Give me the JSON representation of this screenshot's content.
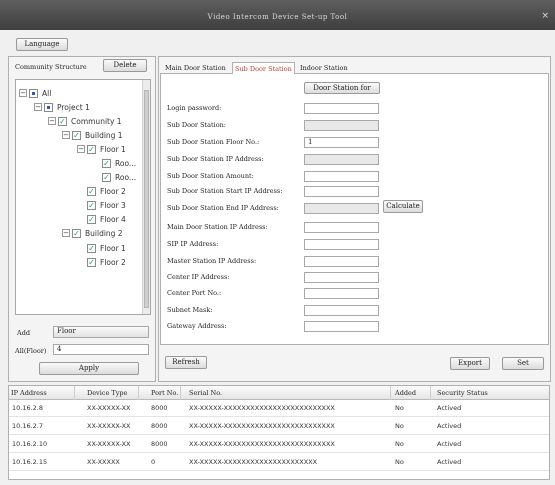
{
  "window": {
    "title": "Video Intercom Device Set-up Tool",
    "close_glyph": "×"
  },
  "top": {
    "language_label": "Language"
  },
  "community": {
    "header": "Community Structure",
    "delete_label": "Delete",
    "tree": [
      {
        "label": "All",
        "expander": "−",
        "check": "part"
      },
      {
        "label": "Project 1",
        "expander": "−",
        "check": "part"
      },
      {
        "label": "Community 1",
        "expander": "−",
        "check": "on"
      },
      {
        "label": "Building 1",
        "expander": "−",
        "check": "on"
      },
      {
        "label": "Floor 1",
        "expander": "−",
        "check": "on"
      },
      {
        "label": "Roo...",
        "expander": "",
        "check": "on"
      },
      {
        "label": "Roo...",
        "expander": "",
        "check": "on"
      },
      {
        "label": "Floor 2",
        "expander": "",
        "check": "on"
      },
      {
        "label": "Floor 3",
        "expander": "",
        "check": "on"
      },
      {
        "label": "Floor 4",
        "expander": "",
        "check": "on"
      },
      {
        "label": "Building 2",
        "expander": "−",
        "check": "on"
      },
      {
        "label": "Floor 1",
        "expander": "",
        "check": "on"
      },
      {
        "label": "Floor 2",
        "expander": "",
        "check": "on"
      }
    ],
    "check_mark": "✓",
    "add_label": "Add",
    "add_select": "Floor",
    "all_floor_label": "All(Floor)",
    "all_floor_value": "4",
    "apply_label": "Apply"
  },
  "tabs": [
    {
      "label": "Main Door Station",
      "active": false
    },
    {
      "label": "Sub Door Station",
      "active": true
    },
    {
      "label": "Indoor Station",
      "active": false
    }
  ],
  "form": {
    "station_type_button": "Door Station for",
    "fields": [
      {
        "label": "Login password:",
        "value": "",
        "disabled": false
      },
      {
        "label": "Sub Door Station:",
        "value": "",
        "disabled": true
      },
      {
        "label": "Sub Door Station Floor No.:",
        "value": "1",
        "disabled": false
      },
      {
        "label": "Sub Door Station IP Address:",
        "value": "",
        "disabled": true
      },
      {
        "label": "Sub Door Station Amount:",
        "value": "",
        "disabled": false
      },
      {
        "label": "Sub Door Station Start IP Address:",
        "value": "",
        "disabled": false
      },
      {
        "label": "Sub Door Station End IP Address:",
        "value": "",
        "disabled": true
      },
      {
        "label": "Main Door Station IP Address:",
        "value": "",
        "disabled": false
      },
      {
        "label": "SIP IP Address:",
        "value": "",
        "disabled": false
      },
      {
        "label": "Master Station IP Address:",
        "value": "",
        "disabled": false
      },
      {
        "label": "Center IP Address:",
        "value": "",
        "disabled": false
      },
      {
        "label": "Center Port No.:",
        "value": "",
        "disabled": false
      },
      {
        "label": "Subnet Mask:",
        "value": "",
        "disabled": false
      },
      {
        "label": "Gateway Address:",
        "value": "",
        "disabled": false
      }
    ],
    "calculate_label": "Calculate"
  },
  "actions": {
    "refresh": "Refresh",
    "export": "Export",
    "set": "Set"
  },
  "device_table": {
    "columns": [
      "IP Address",
      "Device Type",
      "Port No.",
      "Serial No.",
      "Added",
      "Security Status"
    ],
    "rows": [
      [
        "10.16.2.8",
        "XX-XXXXX-XX",
        "8000",
        "XX-XXXXX-XXXXXXXXXXXXXXXXXXXXXXXXX",
        "No",
        "Actived"
      ],
      [
        "10.16.2.7",
        "XX-XXXXX-XX",
        "8000",
        "XX-XXXXX-XXXXXXXXXXXXXXXXXXXXXXXXX",
        "No",
        "Actived"
      ],
      [
        "10.16.2.10",
        "XX-XXXXX-XX",
        "8000",
        "XX-XXXXX-XXXXXXXXXXXXXXXXXXXXXXXXX",
        "No",
        "Actived"
      ],
      [
        "10.16.2.15",
        "XX-XXXXX",
        "0",
        "XX-XXXXX-XXXXXXXXXXXXXXXXXXXXX",
        "No",
        "Actived"
      ]
    ]
  }
}
